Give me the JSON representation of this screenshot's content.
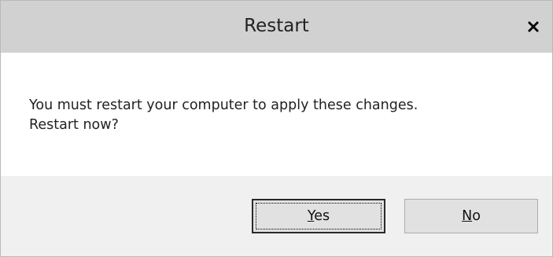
{
  "window": {
    "title": "Restart",
    "close_icon": "close-icon"
  },
  "message": {
    "line1": "You must restart your computer to apply these changes.",
    "line2": "Restart now?"
  },
  "buttons": {
    "yes": {
      "mnemonic": "Y",
      "rest": "es",
      "is_default": true
    },
    "no": {
      "mnemonic": "N",
      "rest": "o",
      "is_default": false
    }
  },
  "colors": {
    "titlebar": "#d1d1d1",
    "footer": "#f0f0f0",
    "button_face": "#e1e1e1"
  }
}
